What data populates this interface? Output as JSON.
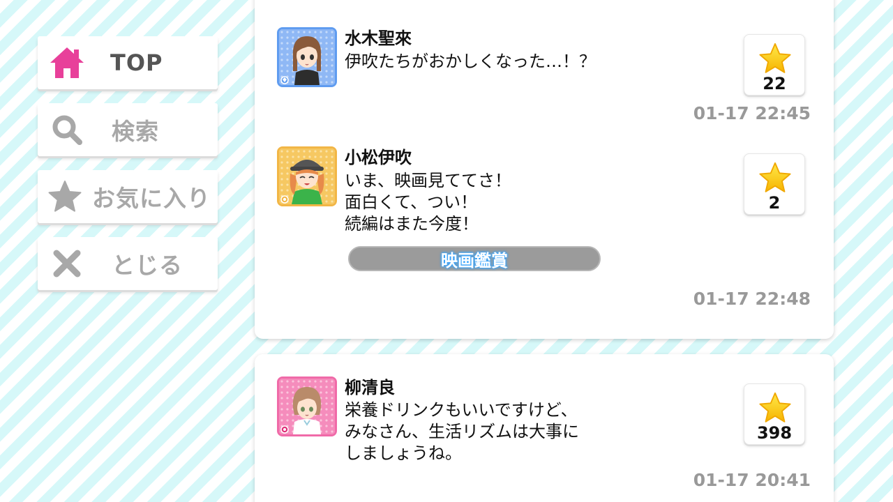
{
  "sidebar": {
    "top_label": "TOP",
    "search_label": "検索",
    "favorites_label": "お気に入り",
    "close_label": "とじる",
    "active_color": "#e8409a"
  },
  "posts": [
    {
      "author": "水木聖來",
      "lines": [
        "伊吹たちがおかしくなった…！？"
      ],
      "likes": "22",
      "time": "01-17 22:45",
      "frame_color": "#5f9cf0",
      "icon": "diamond-icon"
    },
    {
      "author": "小松伊吹",
      "lines": [
        "いま、映画見ててさ！",
        "面白くて、つい！",
        "続編はまた今度！"
      ],
      "tag": "映画鑑賞",
      "likes": "2",
      "time": "01-17 22:48",
      "frame_color": "#f2b646",
      "icon": "sun-icon"
    },
    {
      "author": "柳清良",
      "lines": [
        "栄養ドリンクもいいですけど、",
        "みなさん、生活リズムは大事に",
        "しましょうね。"
      ],
      "likes": "398",
      "time": "01-17 20:41",
      "frame_color": "#f06aa8",
      "icon": "flower-icon"
    }
  ]
}
